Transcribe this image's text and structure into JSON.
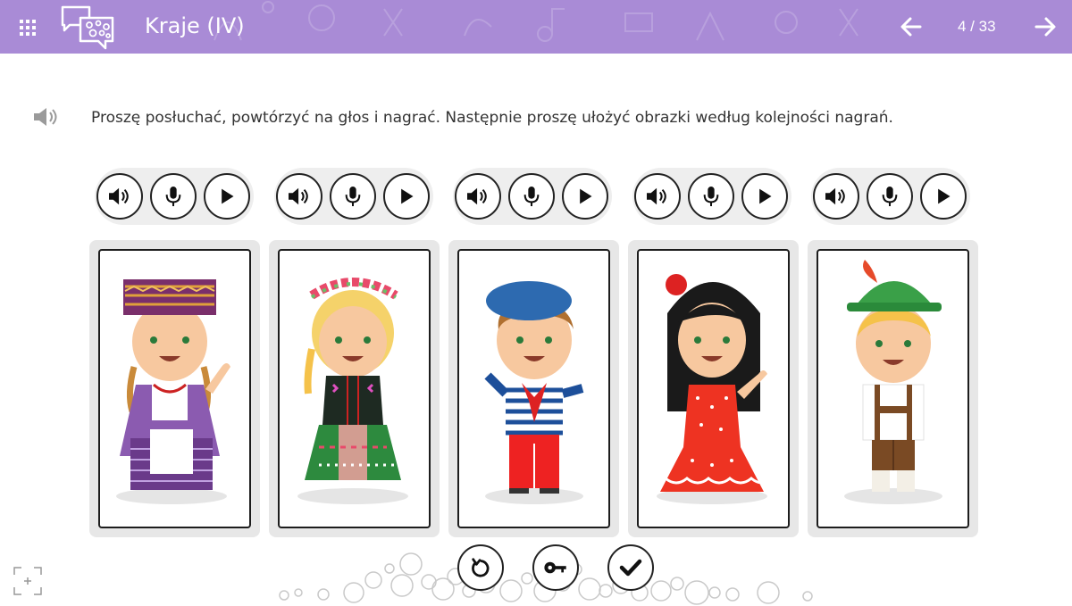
{
  "header": {
    "title": "Kraje (IV)",
    "page_counter": "4 / 33",
    "bg_color": "#a98bd6"
  },
  "instruction": {
    "text": "Proszę posłuchać, powtórzyć na głos i nagrać. Następnie proszę ułożyć obrazki według kolejności nagrań."
  },
  "recorders": [
    {
      "controls": [
        "speaker-icon",
        "microphone-icon",
        "play-icon"
      ]
    },
    {
      "controls": [
        "speaker-icon",
        "microphone-icon",
        "play-icon"
      ]
    },
    {
      "controls": [
        "speaker-icon",
        "microphone-icon",
        "play-icon"
      ]
    },
    {
      "controls": [
        "speaker-icon",
        "microphone-icon",
        "play-icon"
      ]
    },
    {
      "controls": [
        "speaker-icon",
        "microphone-icon",
        "play-icon"
      ]
    }
  ],
  "cards": [
    {
      "depicts": "girl-lithuanian-costume"
    },
    {
      "depicts": "girl-polish-folk-costume"
    },
    {
      "depicts": "boy-french-beret"
    },
    {
      "depicts": "girl-spanish-flamenco-dress"
    },
    {
      "depicts": "boy-german-lederhosen"
    }
  ],
  "footer": {
    "buttons": [
      "reset-icon",
      "key-icon",
      "check-icon"
    ]
  }
}
